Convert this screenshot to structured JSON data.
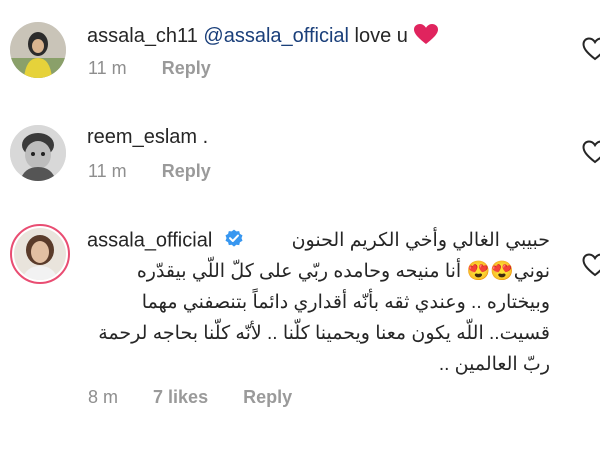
{
  "comments": [
    {
      "username": "assala_ch11",
      "mention": "@assala_official",
      "text": "love u",
      "emoji": "❤️",
      "time": "11 m",
      "reply_label": "Reply"
    },
    {
      "username": "reem_eslam",
      "text": ".",
      "time": "11 m",
      "reply_label": "Reply"
    },
    {
      "username": "assala_official",
      "verified": true,
      "lines": [
        "حبيبي الغالي وأخي الكريم الحنون",
        "نوني😍😍 أنا منيحه وحامده ربّي على كلّ اللّي بيقدّره",
        "وبيختاره .. وعندي ثقه بأنّه أقداري دائماً بتنصفني مهما",
        "قسيت.. اللّه يكون معنا ويحمينا كلّنا .. لأنّه كلّنا بحاجه لرحمة",
        "ربّ العالمين .."
      ],
      "time": "8 m",
      "likes": "7 likes",
      "reply_label": "Reply"
    }
  ],
  "colors": {
    "mention": "#1a3f7a",
    "meta": "#8e8e8e",
    "verified": "#3897f0",
    "heart": "#e0245e"
  }
}
